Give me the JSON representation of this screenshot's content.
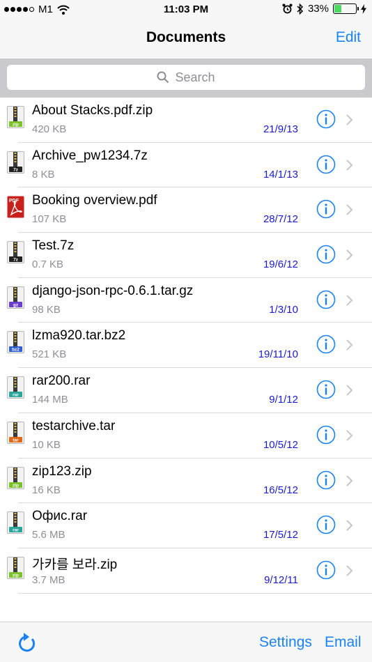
{
  "status_bar": {
    "signal_dots_filled": 4,
    "signal_dots_total": 5,
    "carrier": "M1",
    "wifi_icon": "wifi-icon",
    "time": "11:03 PM",
    "alarm_icon": "alarm-icon",
    "bluetooth_icon": "bluetooth-icon",
    "battery_percent": "33%",
    "battery_level": 0.33,
    "charging_icon": "bolt-icon"
  },
  "nav": {
    "title": "Documents",
    "edit_label": "Edit"
  },
  "search": {
    "placeholder": "Search"
  },
  "files": [
    {
      "name": "About Stacks.pdf.zip",
      "size": "420 KB",
      "date": "21/9/13",
      "icon": "zip"
    },
    {
      "name": "Archive_pw1234.7z",
      "size": "8 KB",
      "date": "14/1/13",
      "icon": "7z"
    },
    {
      "name": "Booking overview.pdf",
      "size": "107 KB",
      "date": "28/7/12",
      "icon": "pdf"
    },
    {
      "name": "Test.7z",
      "size": "0.7 KB",
      "date": "19/6/12",
      "icon": "7z"
    },
    {
      "name": "django-json-rpc-0.6.1.tar.gz",
      "size": "98 KB",
      "date": "1/3/10",
      "icon": "gz"
    },
    {
      "name": "lzma920.tar.bz2",
      "size": "521 KB",
      "date": "19/11/10",
      "icon": "bz2"
    },
    {
      "name": "rar200.rar",
      "size": "144 MB",
      "date": "9/1/12",
      "icon": "rar"
    },
    {
      "name": "testarchive.tar",
      "size": "10 KB",
      "date": "10/5/12",
      "icon": "tar"
    },
    {
      "name": "zip123.zip",
      "size": "16 KB",
      "date": "16/5/12",
      "icon": "zip"
    },
    {
      "name": "Офис.rar",
      "size": "5.6 MB",
      "date": "17/5/12",
      "icon": "rar"
    },
    {
      "name": "가카를 보라.zip",
      "size": "3.7 MB",
      "date": "9/12/11",
      "icon": "zip"
    }
  ],
  "icon_labels": {
    "zip": "zip",
    "7z": "7z",
    "gz": "gz",
    "bz2": "bz2",
    "rar": "rar",
    "tar": "tar",
    "pdf": "PDF"
  },
  "toolbar": {
    "refresh_icon": "refresh-icon",
    "settings_label": "Settings",
    "email_label": "Email"
  },
  "colors": {
    "accent": "#1a82f7",
    "date": "#1a1acf",
    "zip": "#7cc22a",
    "7z": "#222222",
    "gz": "#6a3fd0",
    "bz2": "#2f5fd0",
    "rar": "#2aa79b",
    "tar": "#e06a16",
    "pdf": "#c8201a"
  }
}
